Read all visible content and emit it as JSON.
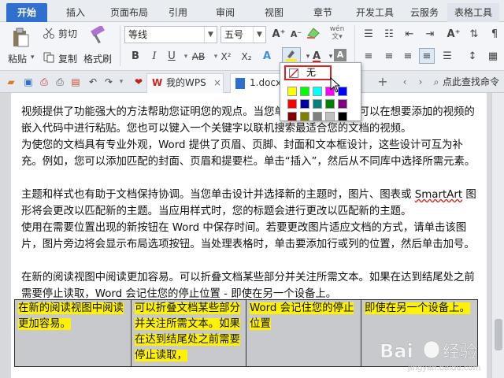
{
  "tabs": [
    "开始",
    "插入",
    "页面布局",
    "引用",
    "审阅",
    "视图",
    "章节",
    "开发工具",
    "云服务",
    "表格工具"
  ],
  "ribbon": {
    "paste": "粘贴",
    "cut": "剪切",
    "copy": "复制",
    "format_painter": "格式刷",
    "font_name": "等线",
    "font_size": "五号",
    "wen": "wén",
    "bold": "B",
    "italic": "I",
    "underline": "U",
    "strike": "AB",
    "sup": "X²",
    "sub": "X₂",
    "font_color_letter": "A"
  },
  "quickbar": {
    "wps_tab": "我的WPS",
    "doc_tab": "1.docx",
    "find": "点此查找命令"
  },
  "popup": {
    "none_label": "无",
    "colors": [
      "#ffff00",
      "#00ff00",
      "#00ffff",
      "#ff00ff",
      "#0000ff",
      "#ff0000",
      "#0000a0",
      "#008080",
      "#008000",
      "#800080",
      "#800000",
      "#808000",
      "#808080",
      "#c0c0c0",
      "#000000"
    ]
  },
  "document": {
    "p1": "视频提供了功能强大的方法帮助您证明您的观点。当您单击联机视频时，可以在想要添加的视频的嵌入代码中进行粘贴。您也可以键入一个关键字以联机搜索最适合您的文档的视频。",
    "p2": "为使您的文档具有专业外观，Word 提供了页眉、页脚、封面和文本框设计，这些设计可互为补充。例如，您可以添加匹配的封面、页眉和提要栏。单击“插入”，然后从不同库中选择所需元素。",
    "p3a": "主题和样式也有助于文档保持协调。当您单击设计并选择新的主题时，图片、图表或 ",
    "p3b": "SmartArt",
    "p3c": " 图形将会更改以匹配新的主题。当应用样式时，您的标题会进行更改以匹配新的主题。",
    "p4": "使用在需要位置出现的新按钮在 Word 中保存时间。若要更改图片适应文档的方式，请单击该图片，图片旁边将会显示布局选项按钮。当处理表格时，单击要添加行或列的位置，然后单击加号。",
    "p5": "在新的阅读视图中阅读更加容易。可以折叠文档某些部分并关注所需文本。如果在达到结尾处之前需要停止读取，Word 会记住您的停止位置 - 即使在另一个设备上。"
  },
  "table": {
    "c1": "在新的阅读视图中阅读更加容易。",
    "c2": "可以折叠文档某些部分并关注所需文本。如果在达到结尾处之前需要停止读取，",
    "c3": "Word 会记住您的停止位置",
    "c4": "即使在另一个设备上。"
  },
  "watermark": {
    "brand": "Bai 经验",
    "url": "jingyan.baidu.com"
  }
}
